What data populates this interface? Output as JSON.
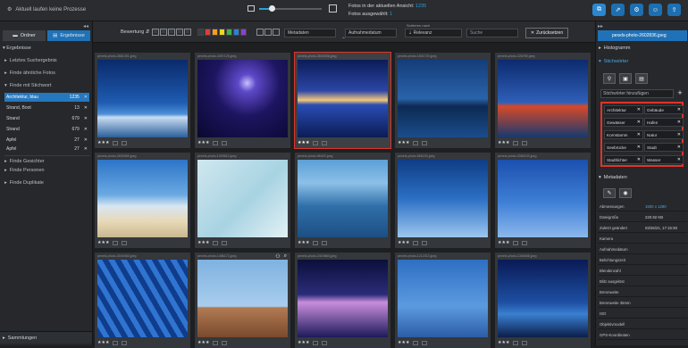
{
  "topbar": {
    "status": "Aktuell laufen keine Prozesse",
    "zoom_percent": 20,
    "counts_line1_label": "Fotos in der aktuellen Ansicht:",
    "counts_line1_value": "1235",
    "counts_line2_label": "Fotos ausgewählt:",
    "counts_line2_value": "1",
    "buttons": [
      "layers-icon",
      "share-icon",
      "settings-icon",
      "people-icon",
      "export-icon"
    ]
  },
  "left": {
    "tabs": [
      {
        "label": "Ordner"
      },
      {
        "label": "Ergebnisse"
      }
    ],
    "section_title": "Ergebnisse",
    "items": [
      {
        "label": "Letztes Suchergebnis"
      },
      {
        "label": "Finde ähnliche Fotos"
      },
      {
        "label": "Finde mit Stichwort"
      }
    ],
    "keywords": [
      {
        "label": "Architektur, blau",
        "count": "1235"
      },
      {
        "label": "Strand, Boot",
        "count": "13"
      },
      {
        "label": "Strand",
        "count": "679"
      },
      {
        "label": "Strand",
        "count": "679"
      },
      {
        "label": "Apfel",
        "count": "27"
      },
      {
        "label": "Apfel",
        "count": "27"
      }
    ],
    "lower_items": [
      {
        "label": "Finde Gesichter"
      },
      {
        "label": "Finde Personen"
      },
      {
        "label": "Finde Duplikate"
      }
    ],
    "collections": "Sammlungen"
  },
  "toolbar": {
    "rating_label": "Bewertung",
    "colors": [
      "#e23b3b",
      "#f0a020",
      "#e8d820",
      "#3bb34a",
      "#2f7fd6",
      "#8f3fd0"
    ],
    "metadata_select": "Metadaten",
    "date_select": "Aufnahmedatum",
    "sort_label": "Sortieren nach",
    "sort_select": "Relevanz",
    "search_placeholder": "Suche",
    "reset_label": "Zurücksetzen"
  },
  "photos": [
    {
      "name": "pexels-photo-2881301.jpeg",
      "stars": "★★★",
      "scene": "city-blue"
    },
    {
      "name": "pexels-photo-4397125.jpeg",
      "stars": "★★★",
      "scene": "lightning"
    },
    {
      "name": "pexels-photo-2602836.jpeg",
      "stars": "★★★",
      "scene": "reflection",
      "selected": true
    },
    {
      "name": "pexels-photo-1501720.jpeg",
      "stars": "★★★",
      "scene": "skyline-water"
    },
    {
      "name": "pexels-photo-226780.jpeg",
      "stars": "★★★",
      "scene": "bridge"
    },
    {
      "name": "pexels-photo-2600969.jpeg",
      "stars": "★★★",
      "scene": "pyramids"
    },
    {
      "name": "pexels-photo-1009610.jpeg",
      "stars": "★★★",
      "scene": "wall"
    },
    {
      "name": "pexels-photo-96402.jpeg",
      "stars": "★★★",
      "scene": "aerial"
    },
    {
      "name": "pexels-photo-566233.jpeg",
      "stars": "★★★",
      "scene": "curved-building"
    },
    {
      "name": "pexels-photo-2082103.jpeg",
      "stars": "★★★",
      "scene": "eiffel"
    },
    {
      "name": "pexels-photo-3049460.jpeg",
      "stars": "★★★",
      "scene": "glass-facade"
    },
    {
      "name": "pexels-photo-1486173.jpeg",
      "stars": "★★★",
      "scene": "tower-sky",
      "hover": true
    },
    {
      "name": "pexels-photo-2419860.jpeg",
      "stars": "★★★",
      "scene": "night-lake"
    },
    {
      "name": "pexels-photo-1212313.jpeg",
      "stars": "★★★",
      "scene": "skyscraper"
    },
    {
      "name": "pexels-photo-1308456.jpeg",
      "stars": "★★★",
      "scene": "hk-night"
    }
  ],
  "right": {
    "file_name": "pexels-photo-2602836.jpeg",
    "histogram": "Histogramm",
    "keywords_title": "Stichwörter",
    "keyword_add_placeholder": "Stichwörter hinzufügen",
    "keywords": [
      "Architektur",
      "Gebäude",
      "Gewässer",
      "Hafen",
      "Kornstamm",
      "Natur",
      "Seebrücke",
      "Stadt",
      "Stadtlichter",
      "Wasser"
    ],
    "metadata_title": "Metadaten",
    "metadata": [
      {
        "k": "Abmessungen",
        "v": "1920 x 1280",
        "link": true
      },
      {
        "k": "Dateigröße",
        "v": "220.92 KB"
      },
      {
        "k": "Zuletzt geändert",
        "v": "03/26/21, 17:15:38"
      },
      {
        "k": "Kamera",
        "v": ""
      },
      {
        "k": "Aufnahmedatum",
        "v": ""
      },
      {
        "k": "Belichtungszeit",
        "v": ""
      },
      {
        "k": "Blendenzahl",
        "v": ""
      },
      {
        "k": "Blitz ausgelöst",
        "v": ""
      },
      {
        "k": "Brennweite",
        "v": ""
      },
      {
        "k": "Brennweite 35mm",
        "v": ""
      },
      {
        "k": "ISO",
        "v": ""
      },
      {
        "k": "Objektivmodell",
        "v": ""
      },
      {
        "k": "GPS-Koordinaten",
        "v": ""
      }
    ]
  }
}
